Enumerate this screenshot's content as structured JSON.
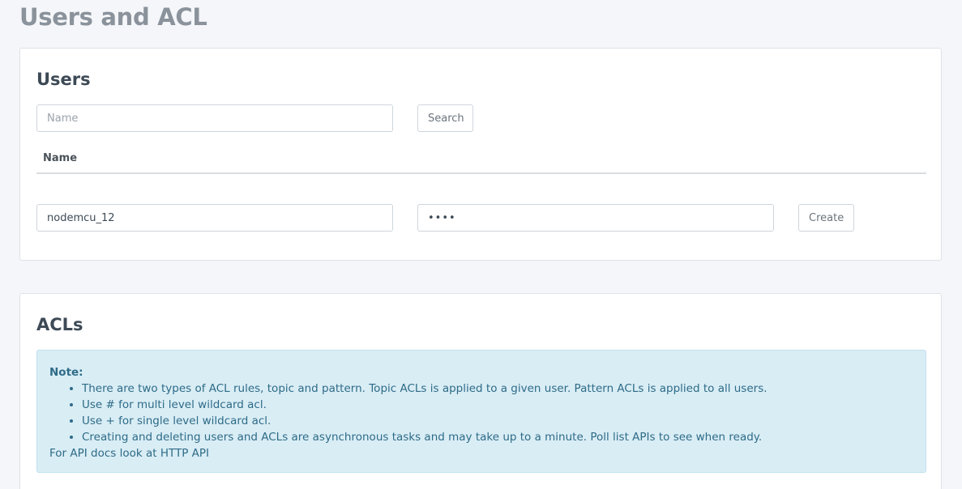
{
  "page": {
    "title": "Users and ACL"
  },
  "users": {
    "title": "Users",
    "search": {
      "placeholder": "Name",
      "value": ""
    },
    "search_button": "Search",
    "table": {
      "columns": [
        "Name"
      ]
    },
    "create": {
      "username_value": "nodemcu_12",
      "password_value": "••••",
      "button": "Create"
    }
  },
  "acls": {
    "title": "ACLs",
    "note": {
      "label": "Note:",
      "items": [
        "There are two types of ACL rules, topic and pattern. Topic ACLs is applied to a given user. Pattern ACLs is applied to all users.",
        "Use # for multi level wildcard acl.",
        "Use + for single level wildcard acl.",
        "Creating and deleting users and ACLs are asynchronous tasks and may take up to a minute. Poll list APIs to see when ready."
      ],
      "footer": "For API docs look at HTTP API"
    }
  },
  "colors": {
    "background": "#f4f6f9",
    "note_background": "#d9edf5",
    "note_text": "#2e6b87",
    "title_gray": "#8a929b"
  }
}
